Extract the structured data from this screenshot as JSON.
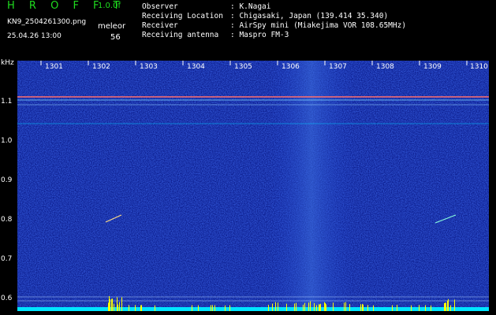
{
  "header": {
    "title": "H R O F F T",
    "version": "1.0.0f",
    "filename": "KN9_2504261300.png",
    "datetime": "25.04.26 13:00",
    "mode": "meleor",
    "count": "56"
  },
  "meta": [
    {
      "key": "Observer",
      "value": ": K.Nagai"
    },
    {
      "key": "Receiving Location",
      "value": ": Chigasaki, Japan (139.414 35.340)"
    },
    {
      "key": "Receiver",
      "value": ": AirSpy mini (Miakejima VOR 108.65MHz)"
    },
    {
      "key": "Receiving antenna",
      "value": ": Maspro FM-3"
    }
  ],
  "axes": {
    "y_unit": "kHz",
    "y_ticks": [
      "1.1",
      "1.0",
      "0.9",
      "0.8",
      "0.7",
      "0.6"
    ],
    "x_ticks": [
      "1301",
      "1302",
      "1303",
      "1304",
      "1305",
      "1306",
      "1307",
      "1308",
      "1309",
      "1310"
    ]
  },
  "colors": {
    "background": "#000000",
    "spectrum": "#0a1a8a",
    "title_green": "#1fdc1f",
    "bottom_bar": "#00e5ff",
    "bursts": "#ffff00",
    "interference_line": "#ff6f6f"
  }
}
